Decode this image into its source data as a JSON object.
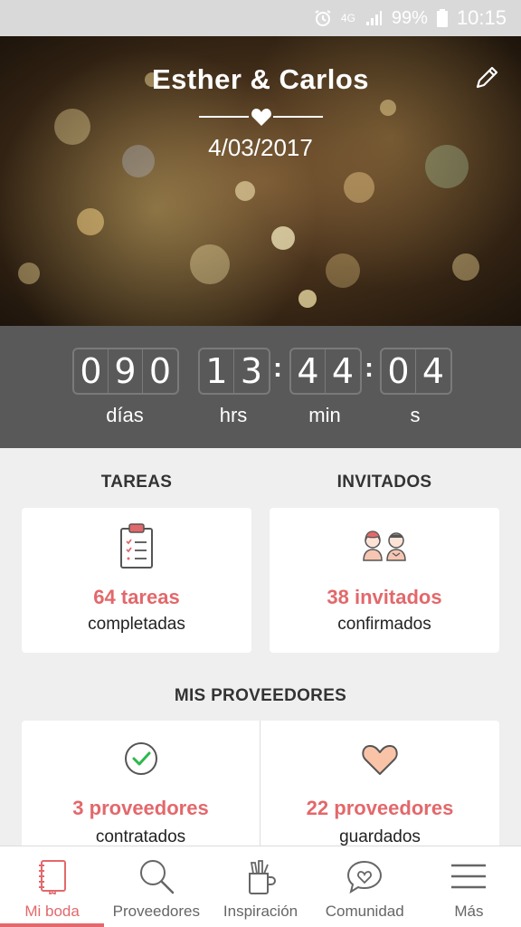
{
  "status_bar": {
    "signal_label": "4G",
    "battery": "99%",
    "time": "10:15",
    "icons": [
      "alarm-icon",
      "signal-icon",
      "battery-icon"
    ]
  },
  "hero": {
    "title": "Esther & Carlos",
    "date": "4/03/2017",
    "edit_icon": "pencil-icon",
    "divider_icon": "heart-icon"
  },
  "countdown": {
    "days": [
      "0",
      "9",
      "0"
    ],
    "hours": [
      "1",
      "3"
    ],
    "minutes": [
      "4",
      "4"
    ],
    "seconds": [
      "0",
      "4"
    ],
    "separator": ":",
    "labels": {
      "days": "días",
      "hours": "hrs",
      "minutes": "min",
      "seconds": "s"
    }
  },
  "tasks": {
    "title": "TAREAS",
    "value": "64 tareas",
    "sub": "completadas",
    "icon": "clipboard-icon"
  },
  "guests": {
    "title": "INVITADOS",
    "value": "38 invitados",
    "sub": "confirmados",
    "icon": "couple-icon"
  },
  "vendors": {
    "title": "MIS PROVEEDORES",
    "hired": {
      "value": "3 proveedores",
      "sub": "contratados",
      "icon": "check-circle-icon"
    },
    "saved": {
      "value": "22 proveedores",
      "sub": "guardados",
      "icon": "heart-icon"
    }
  },
  "nav": {
    "items": [
      {
        "label": "Mi boda",
        "icon": "notebook-icon",
        "active": true
      },
      {
        "label": "Proveedores",
        "icon": "search-icon",
        "active": false
      },
      {
        "label": "Inspiración",
        "icon": "pencil-cup-icon",
        "active": false
      },
      {
        "label": "Comunidad",
        "icon": "chat-heart-icon",
        "active": false
      },
      {
        "label": "Más",
        "icon": "menu-icon",
        "active": false
      }
    ]
  },
  "colors": {
    "accent": "#e3686b",
    "countdown_bg": "#595959",
    "status_bar_bg": "#d9d9d9",
    "page_bg": "#efefef"
  }
}
